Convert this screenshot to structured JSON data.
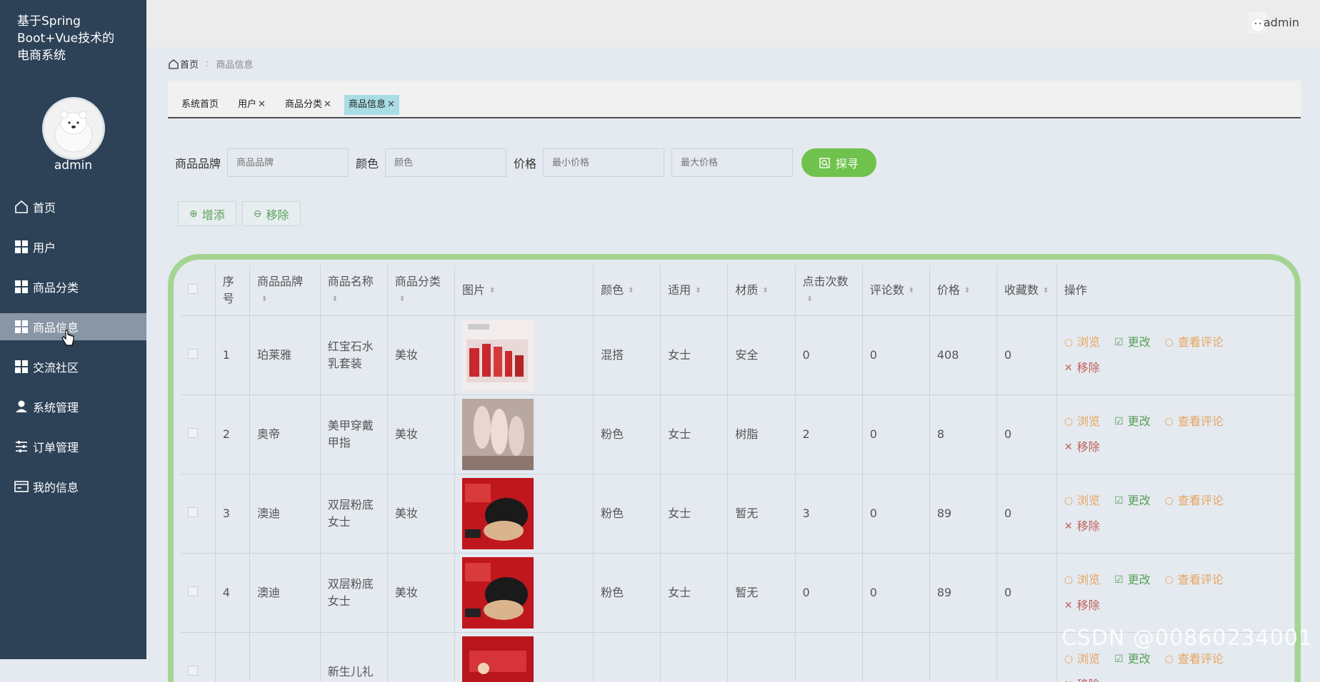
{
  "app": {
    "title": "基于Spring Boot+Vue技术的电商系统",
    "username": "admin"
  },
  "topbar": {
    "username": "admin"
  },
  "menu": [
    {
      "label": "首页",
      "icon": "home-icon"
    },
    {
      "label": "用户",
      "icon": "grid-icon"
    },
    {
      "label": "商品分类",
      "icon": "grid-icon"
    },
    {
      "label": "商品信息",
      "icon": "grid-icon",
      "active": true
    },
    {
      "label": "交流社区",
      "icon": "grid-icon"
    },
    {
      "label": "系统管理",
      "icon": "user-icon"
    },
    {
      "label": "订单管理",
      "icon": "sliders-icon"
    },
    {
      "label": "我的信息",
      "icon": "card-icon"
    }
  ],
  "breadcrumb": {
    "home": "首页",
    "current": "商品信息"
  },
  "tabs": [
    {
      "label": "系统首页",
      "closable": false
    },
    {
      "label": "用户",
      "closable": true
    },
    {
      "label": "商品分类",
      "closable": true
    },
    {
      "label": "商品信息",
      "closable": true,
      "active": true
    }
  ],
  "search": {
    "brand_label": "商品品牌",
    "brand_placeholder": "商品品牌",
    "color_label": "颜色",
    "color_placeholder": "颜色",
    "price_label": "价格",
    "min_placeholder": "最小价格",
    "max_placeholder": "最大价格",
    "button": "探寻"
  },
  "actions": {
    "add": "增添",
    "remove": "移除"
  },
  "table": {
    "headers": [
      "序号",
      "商品品牌",
      "商品名称",
      "商品分类",
      "图片",
      "颜色",
      "适用",
      "材质",
      "点击次数",
      "评论数",
      "价格",
      "收藏数",
      "操作"
    ],
    "ops": {
      "view": "浏览",
      "edit": "更改",
      "comment": "查看评论",
      "delete": "移除"
    },
    "rows": [
      {
        "no": "1",
        "brand": "珀莱雅",
        "name": "红宝石水乳套装",
        "category": "美妆",
        "image": "red-skincare-set",
        "color": "混搭",
        "for": "女士",
        "material": "安全",
        "clicks": "0",
        "comments": "0",
        "price": "408",
        "favorites": "0"
      },
      {
        "no": "2",
        "brand": "奥帝",
        "name": "美甲穿戴甲指",
        "category": "美妆",
        "image": "press-on-nails",
        "color": "粉色",
        "for": "女士",
        "material": "树脂",
        "clicks": "2",
        "comments": "0",
        "price": "8",
        "favorites": "0"
      },
      {
        "no": "3",
        "brand": "澳迪",
        "name": "双层粉底女士",
        "category": "美妆",
        "image": "cushion-foundation",
        "color": "粉色",
        "for": "女士",
        "material": "暂无",
        "clicks": "3",
        "comments": "0",
        "price": "89",
        "favorites": "0"
      },
      {
        "no": "4",
        "brand": "澳迪",
        "name": "双层粉底女士",
        "category": "美妆",
        "image": "cushion-foundation",
        "color": "粉色",
        "for": "女士",
        "material": "暂无",
        "clicks": "0",
        "comments": "0",
        "price": "89",
        "favorites": "0"
      },
      {
        "no": "",
        "brand": "",
        "name": "新生儿礼",
        "category": "",
        "image": "gift-box",
        "color": "",
        "for": "",
        "material": "",
        "clicks": "",
        "comments": "",
        "price": "",
        "favorites": ""
      }
    ]
  },
  "watermark": "CSDN @00860234001",
  "colors": {
    "sidebar": "#2d4257",
    "accent_green": "#6fc24b",
    "table_border": "#a5d491",
    "tab_active": "#a9dde6"
  }
}
